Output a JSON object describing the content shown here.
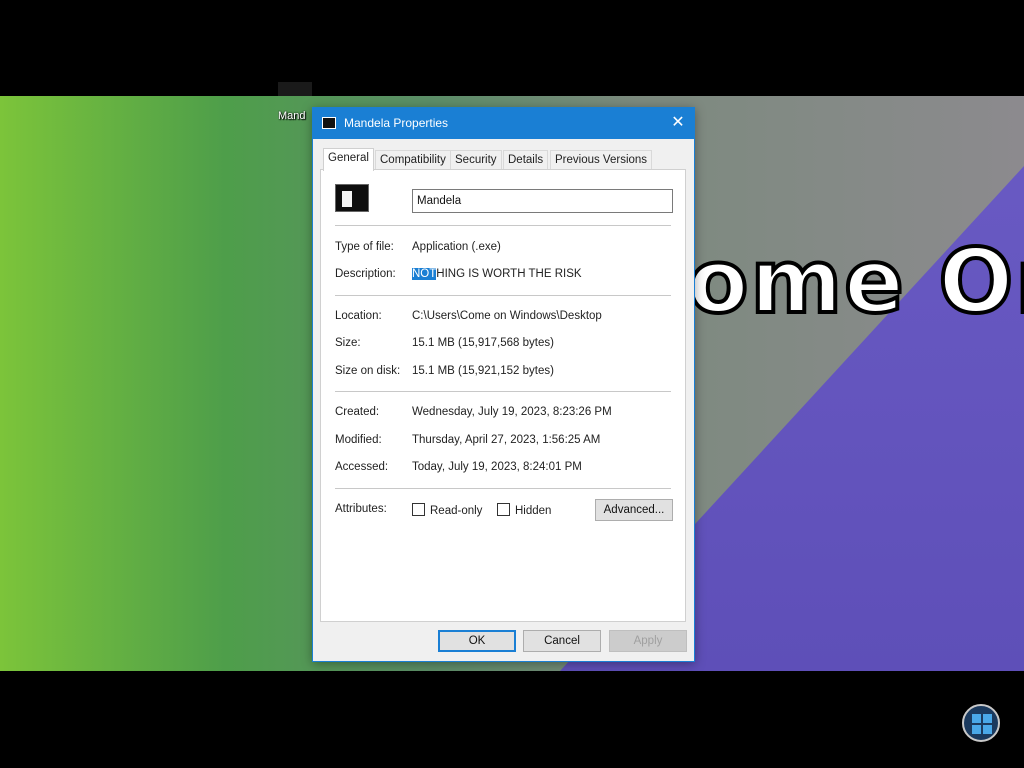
{
  "desktop": {
    "wallpaper_text": "ome On",
    "icon_label": "Mand"
  },
  "dialog": {
    "title": "Mandela Properties",
    "close_glyph": "✕",
    "tabs": [
      "General",
      "Compatibility",
      "Security",
      "Details",
      "Previous Versions"
    ],
    "active_tab": "General",
    "name_value": "Mandela",
    "type_label": "Type of file:",
    "type_value": "Application (.exe)",
    "description_label": "Description:",
    "description_highlighted": "NOT",
    "description_rest": "HING IS WORTH THE RISK",
    "location_label": "Location:",
    "location_value": "C:\\Users\\Come on Windows\\Desktop",
    "size_label": "Size:",
    "size_value": "15.1 MB (15,917,568 bytes)",
    "size_on_disk_label": "Size on disk:",
    "size_on_disk_value": "15.1 MB (15,921,152 bytes)",
    "created_label": "Created:",
    "created_value": "Wednesday, July 19, 2023, 8:23:26 PM",
    "modified_label": "Modified:",
    "modified_value": "Thursday, April 27, 2023, 1:56:25 AM",
    "accessed_label": "Accessed:",
    "accessed_value": "Today, July 19, 2023, 8:24:01 PM",
    "attributes_label": "Attributes:",
    "readonly_label": "Read-only",
    "readonly_checked": false,
    "hidden_label": "Hidden",
    "hidden_checked": false,
    "advanced_label": "Advanced...",
    "ok_label": "OK",
    "cancel_label": "Cancel",
    "apply_label": "Apply"
  },
  "colors": {
    "accent": "#1a7fd4",
    "dialog_bg": "#f0f0f0",
    "panel_bg": "#ffffff"
  },
  "icons": {
    "file_icon": "application-exe-icon",
    "title_icon": "application-icon",
    "corner_logo": "windows-logo-icon"
  }
}
